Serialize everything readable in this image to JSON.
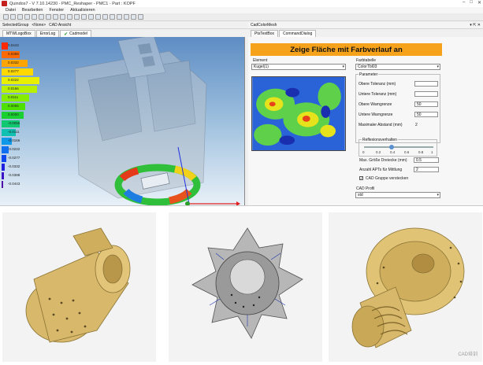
{
  "window": {
    "title": "Quindos7 - V 7.10.14230 - PMC_Reshaper - PMC1 - Part : KOPF",
    "controls": [
      "–",
      "□",
      "✕"
    ]
  },
  "menu": {
    "items": [
      "Datei",
      "Bearbeiten",
      "Fenster",
      "Aktualisieren"
    ]
  },
  "toolbar": {
    "button_count": 20
  },
  "selection": {
    "label": "SelectedGroup",
    "value": "<None>",
    "view_label": "CAD Ansicht"
  },
  "cad_header": {
    "title": "CadColorMesh",
    "buttons": [
      "▾",
      "⇱",
      "✕"
    ]
  },
  "left_tabs": [
    "MTWLogoBox",
    "ErrorLog",
    "Cadmodel"
  ],
  "legend": {
    "values": [
      "0.0443",
      "0.0388",
      "0.0332",
      "0.0277",
      "0.0222",
      "0.0166",
      "0.0111",
      "0.0055",
      "0.0000",
      "-0.0055",
      "-0.0111",
      "-0.0166",
      "-0.0222",
      "-0.0277",
      "-0.0332",
      "-0.0388",
      "-0.0443"
    ],
    "colors": [
      "#ff2a00",
      "#ff6a00",
      "#ffa400",
      "#ffd800",
      "#e8f000",
      "#b8f000",
      "#86ec00",
      "#4ee000",
      "#18d030",
      "#10c870",
      "#10c0b0",
      "#1098e8",
      "#1070f0",
      "#1048f0",
      "#2020e0",
      "#3a10c8",
      "#5010a8"
    ],
    "bar_fill": [
      0.15,
      0.45,
      0.65,
      0.8,
      0.95,
      0.9,
      0.7,
      0.6,
      0.55,
      0.45,
      0.35,
      0.25,
      0.18,
      0.12,
      0.08,
      0.06,
      0.04
    ]
  },
  "right_tabs": [
    "PtsTextBox",
    "CommandDialog"
  ],
  "dialog": {
    "banner": "Zeige Fläche mit Farbverlauf an",
    "banner_color": "#f7a21b",
    "element_label": "Element",
    "element_value": "Kugel(1)",
    "colortable_label": "Farbtabelle",
    "colortable_value": "ColorTbl03",
    "params_title": "Parameter",
    "params": [
      {
        "label": "Obere Toleranz (mm)",
        "value": ""
      },
      {
        "label": "Untere Toleranz (mm)",
        "value": ""
      },
      {
        "label": "Obere Warngrenze",
        "value": "50"
      },
      {
        "label": "Untere Warngrenze",
        "value": "50"
      },
      {
        "label": "Maximaler Abstand (mm)",
        "value": "2"
      }
    ],
    "reflex_title": "Reflexionsverhalten",
    "reflex_ticks": [
      "0",
      "0.2",
      "0.4",
      "0.6",
      "0.8",
      "1"
    ],
    "reflex_value": 0.4,
    "max_triangle_label": "Max. Größe Dreiecke (mm)",
    "max_triangle_value": "0.5",
    "apts_label": "Anzahl APTs für Mittlung",
    "apts_value": "2",
    "hide_group_label": "CAD Gruppe verstecken",
    "hide_group_checked": true,
    "cad_profile_label": "CAD Profil",
    "cad_profile_value": "std"
  },
  "watermark": "CAD培训"
}
